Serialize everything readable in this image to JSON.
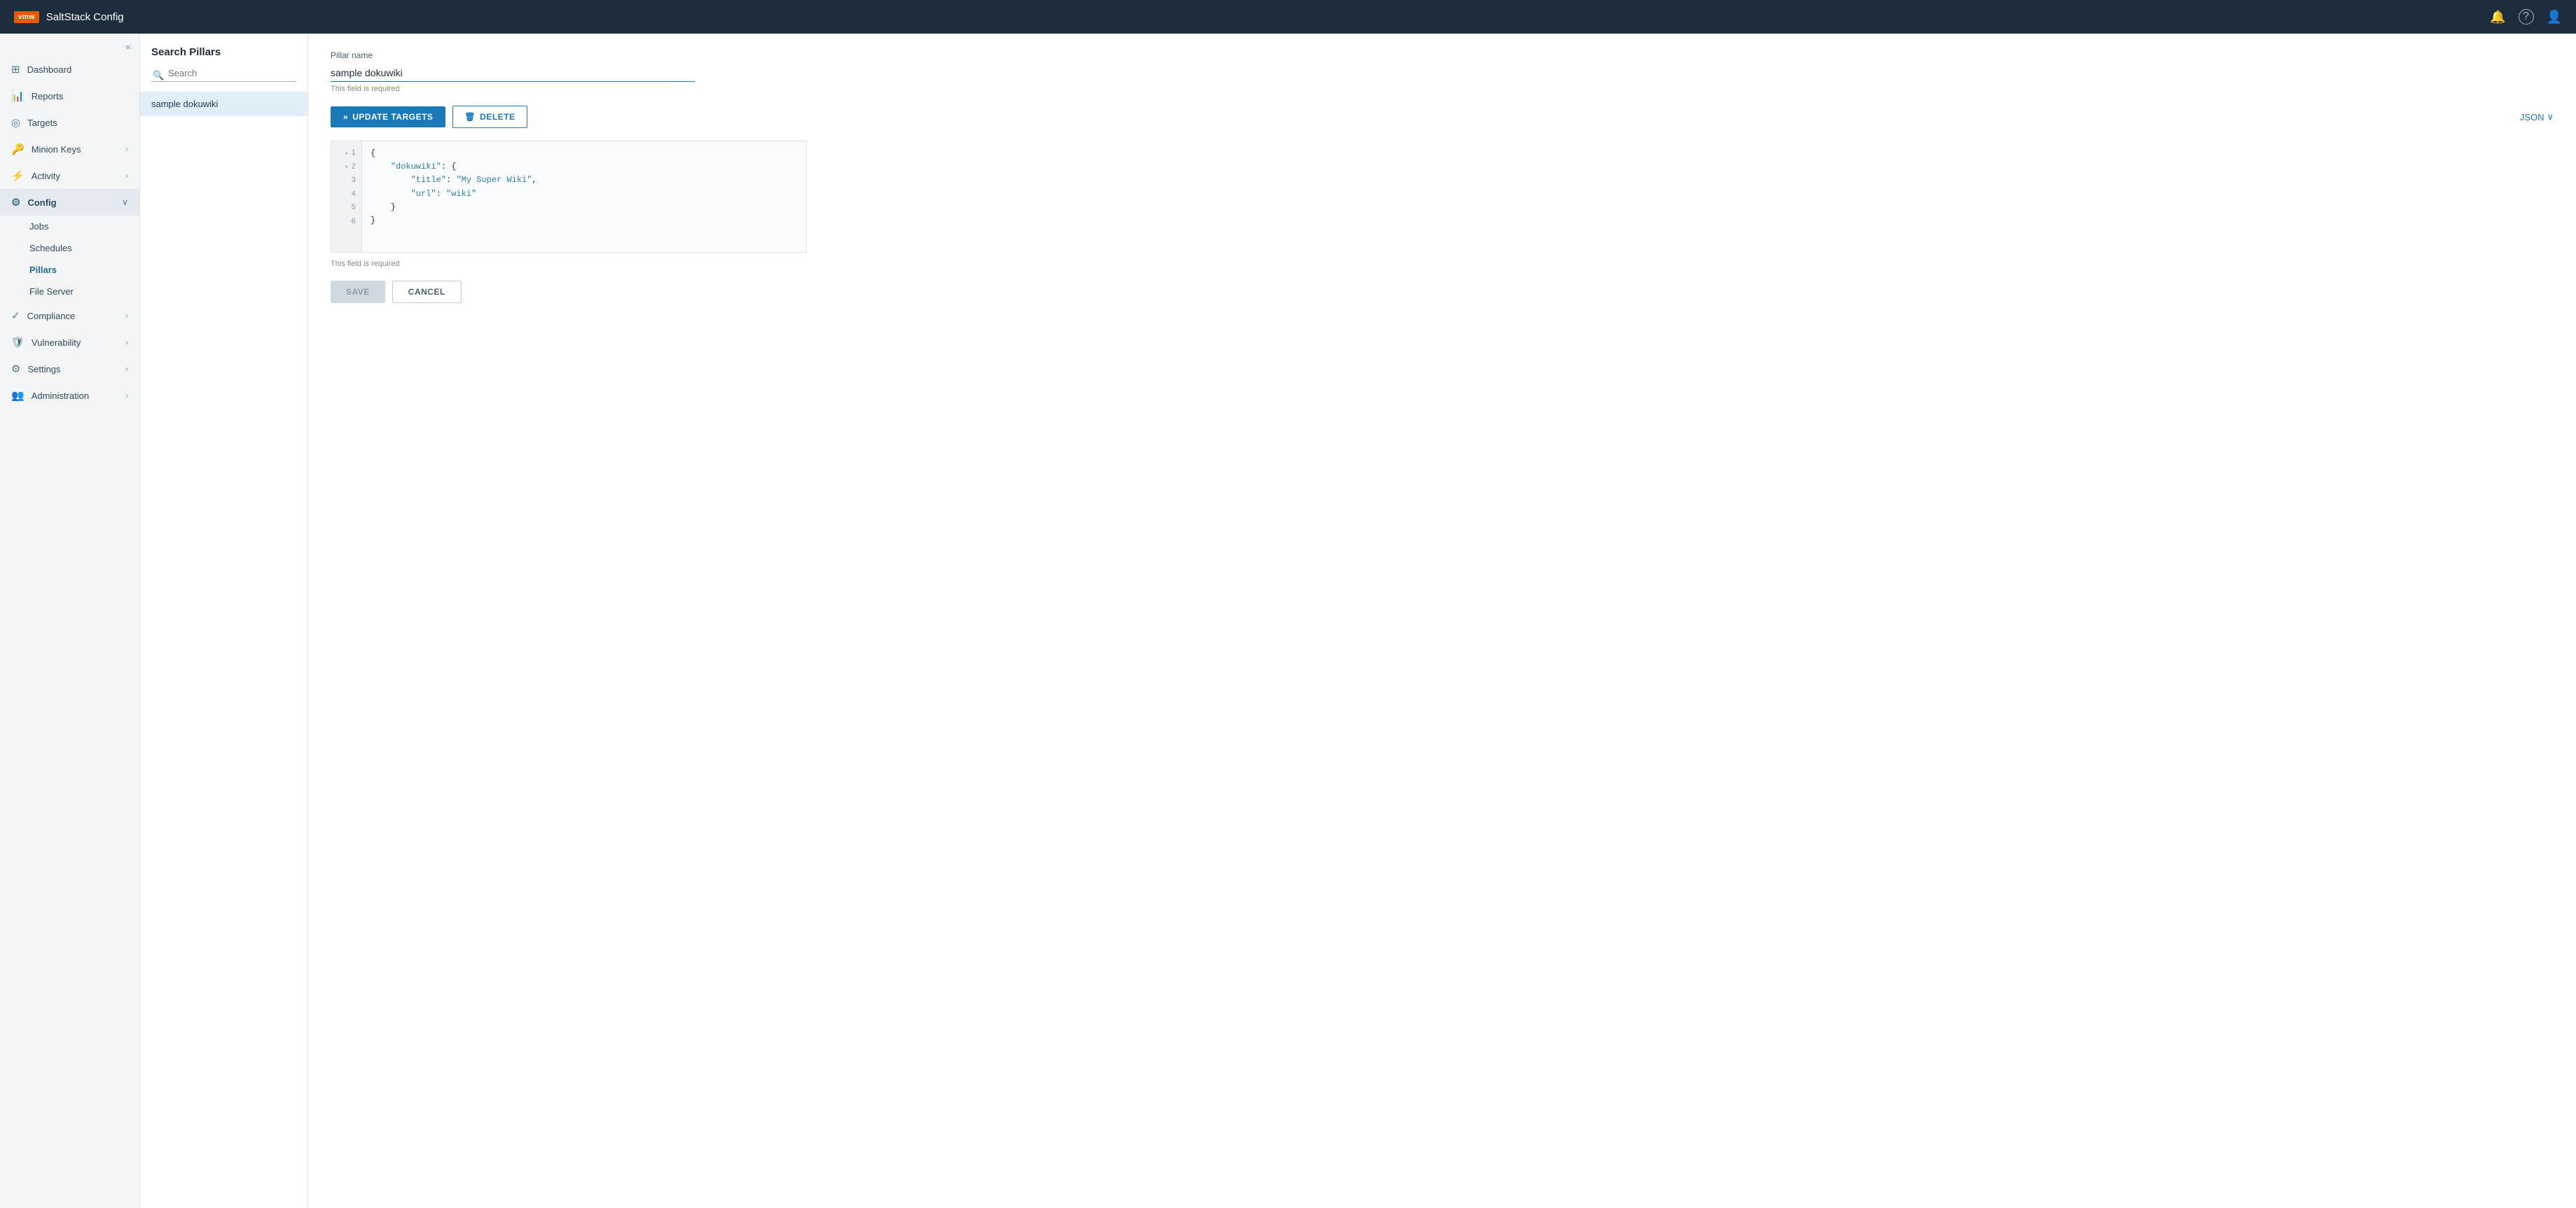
{
  "app": {
    "logo": "vmw",
    "title": "SaltStack Config"
  },
  "topnav": {
    "bell_icon": "🔔",
    "help_icon": "?",
    "user_icon": "👤"
  },
  "sidebar": {
    "collapse_icon": "«",
    "items": [
      {
        "id": "dashboard",
        "label": "Dashboard",
        "icon": "⊞",
        "has_children": false
      },
      {
        "id": "reports",
        "label": "Reports",
        "icon": "📊",
        "has_children": false
      },
      {
        "id": "targets",
        "label": "Targets",
        "icon": "◎",
        "has_children": false
      },
      {
        "id": "minion-keys",
        "label": "Minion Keys",
        "icon": "🔑",
        "has_children": true
      },
      {
        "id": "activity",
        "label": "Activity",
        "icon": "⚡",
        "has_children": true
      },
      {
        "id": "config",
        "label": "Config",
        "icon": "⚙",
        "has_children": true,
        "expanded": true
      }
    ],
    "config_children": [
      {
        "id": "jobs",
        "label": "Jobs"
      },
      {
        "id": "schedules",
        "label": "Schedules"
      },
      {
        "id": "pillars",
        "label": "Pillars",
        "active": true
      },
      {
        "id": "file-server",
        "label": "File Server"
      }
    ],
    "bottom_items": [
      {
        "id": "compliance",
        "label": "Compliance",
        "icon": "✓",
        "has_children": true
      },
      {
        "id": "vulnerability",
        "label": "Vulnerability",
        "icon": "🛡",
        "has_children": true
      },
      {
        "id": "settings",
        "label": "Settings",
        "icon": "⚙",
        "has_children": true
      },
      {
        "id": "administration",
        "label": "Administration",
        "icon": "👥",
        "has_children": true
      }
    ]
  },
  "search_panel": {
    "title": "Search Pillars",
    "search_placeholder": "Search",
    "items": [
      {
        "id": "sample-dokuwiki",
        "label": "sample dokuwiki",
        "active": true
      }
    ]
  },
  "detail": {
    "pillar_name_label": "Pillar name",
    "pillar_name_value": "sample dokuwiki",
    "field_required_text": "This field is required",
    "update_targets_label": "UPDATE TARGETS",
    "delete_label": "DELETE",
    "json_toggle_label": "JSON",
    "code_lines": [
      {
        "num": "1",
        "fold": true,
        "code": "{",
        "class": "c-brace"
      },
      {
        "num": "2",
        "fold": true,
        "code": "    \"dokuwiki\": {",
        "class": "c-key"
      },
      {
        "num": "3",
        "fold": false,
        "code": "        \"title\": \"My Super Wiki\",",
        "class": ""
      },
      {
        "num": "4",
        "fold": false,
        "code": "        \"url\": \"wiki\"",
        "class": ""
      },
      {
        "num": "5",
        "fold": false,
        "code": "    }",
        "class": ""
      },
      {
        "num": "6",
        "fold": false,
        "code": "}",
        "class": ""
      }
    ],
    "code_required_text": "This field is required",
    "save_label": "SAVE",
    "cancel_label": "CANCEL"
  }
}
